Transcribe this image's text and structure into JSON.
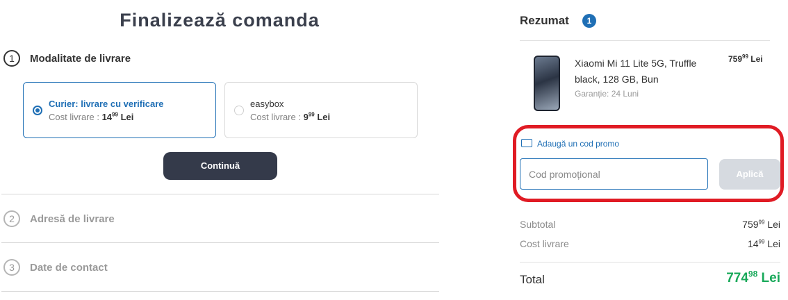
{
  "page_title": "Finalizează comanda",
  "steps": [
    {
      "number": "1",
      "label": "Modalitate de livrare"
    },
    {
      "number": "2",
      "label": "Adresă de livrare"
    },
    {
      "number": "3",
      "label": "Date de contact"
    }
  ],
  "delivery_options": [
    {
      "title": "Curier: livrare cu verificare",
      "cost_label": "Cost livrare : ",
      "cost_main": "14",
      "cost_cents": "99",
      "currency": " Lei",
      "selected": true
    },
    {
      "title": "easybox",
      "cost_label": "Cost livrare : ",
      "cost_main": "9",
      "cost_cents": "99",
      "currency": " Lei",
      "selected": false
    }
  ],
  "continue_button": "Continuă",
  "summary": {
    "title": "Rezumat",
    "count": "1",
    "product": {
      "name": "Xiaomi Mi 11 Lite 5G, Truffle black, 128 GB, Bun",
      "warranty": "Garanție: 24 Luni",
      "price_main": "759",
      "price_cents": "99",
      "currency": " Lei"
    },
    "promo": {
      "link": "Adaugă un cod promo",
      "placeholder": "Cod promoțional",
      "apply": "Aplică"
    },
    "subtotal": {
      "label": "Subtotal",
      "main": "759",
      "cents": "99",
      "currency": " Lei"
    },
    "shipping": {
      "label": "Cost livrare",
      "main": "14",
      "cents": "99",
      "currency": " Lei"
    },
    "total": {
      "label": "Total",
      "main": "774",
      "cents": "98",
      "currency": " Lei"
    }
  },
  "colors": {
    "accent": "#1f6fb5",
    "highlight": "#e01b24",
    "total": "#19a95a",
    "button": "#343a4a"
  }
}
